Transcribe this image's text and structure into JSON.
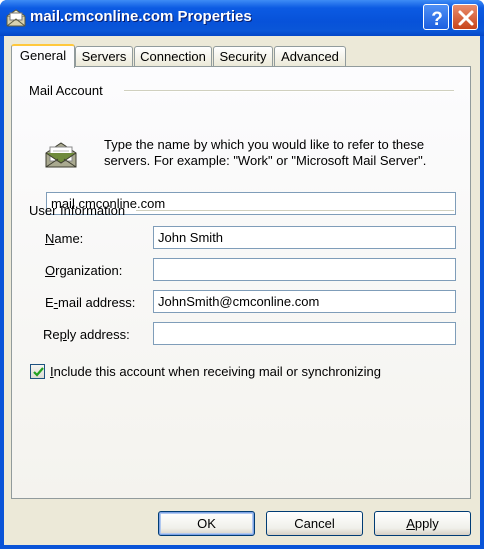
{
  "window": {
    "title": "mail.cmconline.com Properties",
    "help_glyph": "?",
    "icons": {
      "title": "mail-account-icon",
      "help": "help-icon",
      "close": "close-icon"
    }
  },
  "tabs": [
    {
      "label": "General",
      "active": true
    },
    {
      "label": "Servers",
      "active": false
    },
    {
      "label": "Connection",
      "active": false
    },
    {
      "label": "Security",
      "active": false
    },
    {
      "label": "Advanced",
      "active": false
    }
  ],
  "mail_account": {
    "group_label": "Mail Account",
    "icon": "mail-envelope-icon",
    "description": "Type the name by which you would like to refer to these servers.  For example: \"Work\" or \"Microsoft Mail Server\".",
    "account_name": "mail.cmconline.com"
  },
  "user_info": {
    "group_label": "User Information",
    "name": {
      "accel": "N",
      "rest": "ame:",
      "value": "John Smith"
    },
    "organization": {
      "accel": "O",
      "rest": "rganization:",
      "value": ""
    },
    "email": {
      "prefix": "E",
      "accel": "-",
      "rest": "mail address:",
      "value": "JohnSmith@cmconline.com"
    },
    "reply": {
      "prefix": "Re",
      "accel": "p",
      "rest": "ly address:",
      "value": ""
    }
  },
  "include_account": {
    "checked": true,
    "accel": "I",
    "rest": "nclude this account when receiving mail or synchronizing"
  },
  "buttons": {
    "ok": "OK",
    "cancel": "Cancel",
    "apply_accel": "A",
    "apply_rest": "pply"
  },
  "colors": {
    "titlebar": "#0a56d8",
    "dialog_bg": "#ece9d8",
    "active_tab_accent": "#ffc83c",
    "check_mark": "#21a121"
  }
}
